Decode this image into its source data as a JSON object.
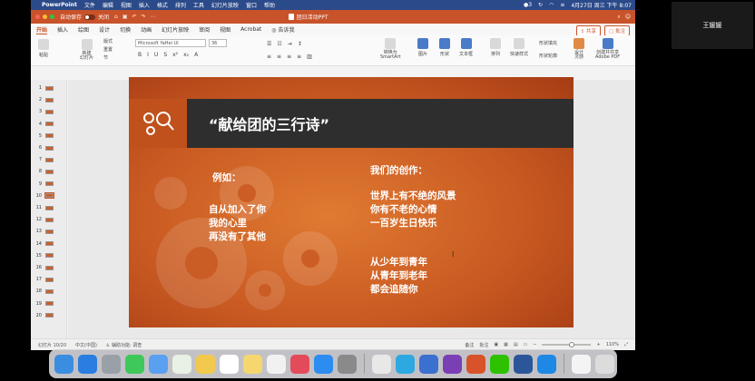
{
  "menubar": {
    "app_name": "PowerPoint",
    "items": [
      "文件",
      "编辑",
      "视图",
      "插入",
      "格式",
      "排列",
      "工具",
      "幻灯片放映",
      "窗口",
      "帮助"
    ],
    "badge_count": "3",
    "datetime": "4月27日 周三 下午 8:07"
  },
  "participant": {
    "name": "王媛媛"
  },
  "titlebar": {
    "autosave_label": "自动保存",
    "autosave_state": "关闭",
    "doc_title": "团日活动PPT"
  },
  "tabs": {
    "items": [
      "开始",
      "插入",
      "绘图",
      "设计",
      "切换",
      "动画",
      "幻灯片放映",
      "审阅",
      "视图",
      "Acrobat"
    ],
    "tell_me": "告诉我",
    "share": "共享",
    "comments": "批注"
  },
  "ribbon": {
    "paste": "粘贴",
    "new_slide": "新建\n幻灯片",
    "layout": "版式",
    "reset": "重置",
    "section": "节",
    "font_name": "Microsoft YaHei UI",
    "font_size": "36",
    "convert_smartart": "转换为\nSmartArt",
    "picture": "图片",
    "shape": "形状",
    "textbox": "文本框",
    "arrange": "排列",
    "quick_styles": "快速样式",
    "shape_fill": "形状填充",
    "shape_outline": "形状轮廓",
    "design_ideas": "设计\n灵感",
    "create_share_pdf": "创建并共享\nAdobe PDF"
  },
  "thumbnails": [
    "1",
    "2",
    "3",
    "4",
    "5",
    "6",
    "7",
    "8",
    "9",
    "10",
    "11",
    "12",
    "13",
    "14",
    "15",
    "16",
    "17",
    "18",
    "19",
    "20"
  ],
  "selected_slide": 10,
  "slide": {
    "title": "“献给团的三行诗”",
    "example_label": "例如：",
    "example_lines": [
      "自从加入了你",
      "我的心里",
      "再没有了其他"
    ],
    "creation_label": "我们的创作：",
    "poem1": [
      "世界上有不绝的风景",
      "你有不老的心情",
      "一百岁生日快乐"
    ],
    "poem2": [
      "从少年到青年",
      "从青年到老年",
      "都会追随你"
    ]
  },
  "statusbar": {
    "slide_counter": "幻灯片 10/20",
    "language": "中文(中国)",
    "accessibility": "辅助功能: 调查",
    "notes": "备注",
    "comments": "批注",
    "zoom": "110%",
    "zoom_level": 0.6
  },
  "colors": {
    "accent": "#c8532a",
    "slide_orange": "#d96a2a",
    "banner_dark": "#2e2e2e"
  }
}
